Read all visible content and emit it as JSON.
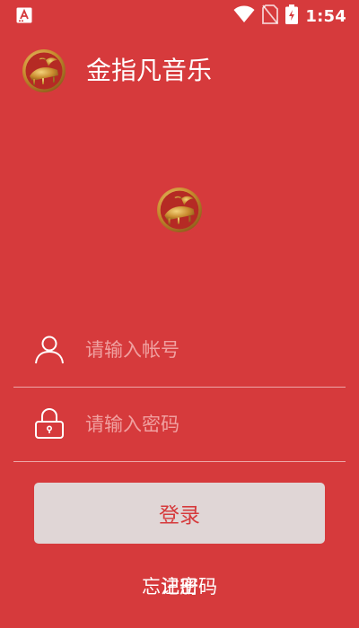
{
  "status_bar": {
    "notification_icon": "a-letter-notification-icon",
    "wifi_icon": "wifi-icon",
    "sim_icon": "no-sim-icon",
    "battery_icon": "battery-charging-icon",
    "time": "1:54"
  },
  "header": {
    "logo_icon": "piano-logo-icon",
    "title": "金指凡音乐"
  },
  "center": {
    "logo_icon": "piano-logo-icon"
  },
  "form": {
    "account": {
      "icon": "user-icon",
      "value": "",
      "placeholder": "请输入帐号"
    },
    "password": {
      "icon": "lock-icon",
      "value": "",
      "placeholder": "请输入密码"
    },
    "login_label": "登录"
  },
  "links": {
    "forgot_password": "忘记密码",
    "register": "注册"
  },
  "colors": {
    "background": "#d63a3c",
    "button_background": "#e0d6d6",
    "button_text": "#d63a3c",
    "placeholder": "#f0a0a0",
    "logo_gold": "#d9a441"
  }
}
